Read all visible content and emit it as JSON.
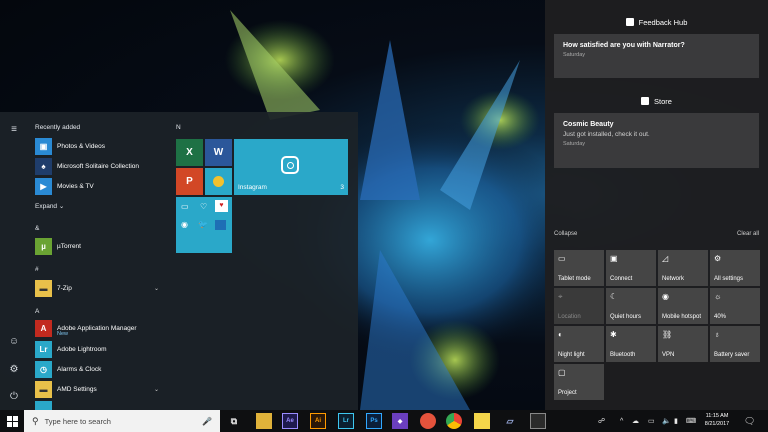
{
  "start_menu": {
    "recently_added_label": "Recently added",
    "recent_apps": [
      "Photos & Videos",
      "Microsoft Solitaire Collection",
      "Movies & TV"
    ],
    "expand_label": "Expand",
    "sections": {
      "amp": "&",
      "hash": "#",
      "a": "A"
    },
    "apps_amp": [
      "µTorrent"
    ],
    "apps_hash": [
      "7-Zip"
    ],
    "apps_a": [
      "Adobe Application Manager",
      "Adobe Lightroom",
      "Alarms & Clock",
      "AMD Settings"
    ],
    "new_badge": "New",
    "tile_group_label": "N",
    "instagram_tile": {
      "label": "Instagram",
      "badge": "3"
    },
    "tile_letters": {
      "excel": "X",
      "word": "W",
      "powerpoint": "P"
    },
    "icons": [
      "menu-icon",
      "user-avatar-icon",
      "gear-icon",
      "power-icon"
    ]
  },
  "action_center": {
    "groups": [
      {
        "app": "Feedback Hub",
        "title": "How satisfied are you with Narrator?",
        "body": "",
        "date": "Saturday"
      },
      {
        "app": "Store",
        "title": "Cosmic Beauty",
        "body": "Just got installed, check it out.",
        "date": "Saturday"
      }
    ],
    "collapse_label": "Collapse",
    "clear_all_label": "Clear all",
    "quick_actions": [
      {
        "label": "Tablet mode",
        "icon": "tablet-icon",
        "enabled": true
      },
      {
        "label": "Connect",
        "icon": "connect-icon",
        "enabled": true
      },
      {
        "label": "Network",
        "icon": "network-icon",
        "enabled": true
      },
      {
        "label": "All settings",
        "icon": "gear-icon",
        "enabled": true
      },
      {
        "label": "Location",
        "icon": "location-icon",
        "enabled": false
      },
      {
        "label": "Quiet hours",
        "icon": "moon-icon",
        "enabled": true
      },
      {
        "label": "Mobile hotspot",
        "icon": "hotspot-icon",
        "enabled": true
      },
      {
        "label": "40%",
        "icon": "brightness-icon",
        "enabled": true
      },
      {
        "label": "Night light",
        "icon": "night-light-icon",
        "enabled": true
      },
      {
        "label": "Bluetooth",
        "icon": "bluetooth-icon",
        "enabled": true
      },
      {
        "label": "VPN",
        "icon": "vpn-icon",
        "enabled": true
      },
      {
        "label": "Battery saver",
        "icon": "battery-saver-icon",
        "enabled": true
      },
      {
        "label": "Project",
        "icon": "project-icon",
        "enabled": true
      }
    ]
  },
  "taskbar": {
    "search_placeholder": "Type here to search",
    "pinned_letters": {
      "ae": "Ae",
      "ai": "Ai",
      "lr": "Lr",
      "ps": "Ps"
    },
    "time": "11:15 AM",
    "date": "8/21/2017"
  },
  "colors": {
    "tile_blue": "#2aa8c9",
    "excel_green": "#1e7145",
    "word_blue": "#2b579a",
    "ppt_orange": "#d24726",
    "accent": "#0078d7"
  }
}
